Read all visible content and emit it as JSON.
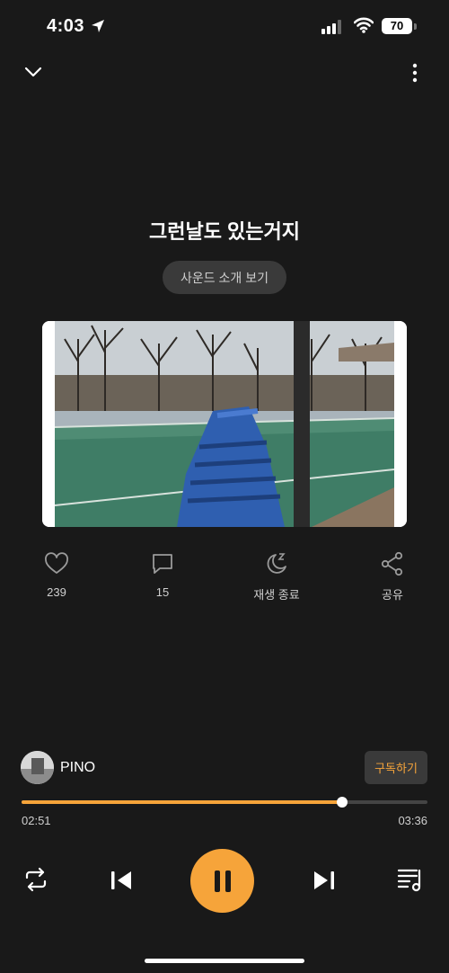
{
  "status_bar": {
    "time": "4:03",
    "battery": "70"
  },
  "track": {
    "title": "그런날도 있는거지",
    "intro_label": "사운드 소개 보기"
  },
  "actions": [
    {
      "icon": "heart-icon",
      "label": "239"
    },
    {
      "icon": "comment-icon",
      "label": "15"
    },
    {
      "icon": "sleep-timer-icon",
      "label": "재생 종료"
    },
    {
      "icon": "share-icon",
      "label": "공유"
    }
  ],
  "artist": {
    "name": "PINO",
    "subscribe_label": "구독하기"
  },
  "progress": {
    "current": "02:51",
    "total": "03:36",
    "fraction": 0.79
  },
  "controls": {
    "icons": [
      "repeat-icon",
      "previous-icon",
      "pause-icon",
      "next-icon",
      "playlist-icon"
    ]
  },
  "colors": {
    "accent": "#f6a43a",
    "background": "#191919"
  }
}
